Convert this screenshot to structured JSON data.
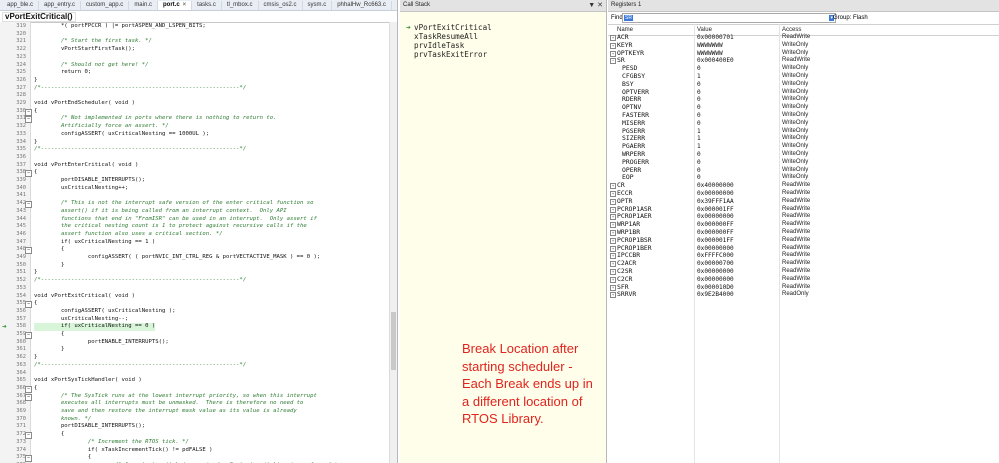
{
  "editor": {
    "tabs": [
      "app_ble.c",
      "app_entry.c",
      "custom_app.c",
      "main.c",
      "port.c",
      "tasks.c",
      "tl_mbox.c",
      "cmsis_os2.c",
      "sysm.c",
      "phhalHw_Rc663.c"
    ],
    "active_tab": "port.c",
    "function_selector": "vPortExitCritical()",
    "lines": [
      {
        "n": "319",
        "t": "        *( portFPCCR ) |= portASPEN_AND_LSPEN_BITS;",
        "c": "code"
      },
      {
        "n": "320",
        "t": "",
        "c": "code"
      },
      {
        "n": "321",
        "t": "        /* Start the first task. */",
        "c": "cm"
      },
      {
        "n": "322",
        "t": "        vPortStartFirstTask();",
        "c": "code"
      },
      {
        "n": "323",
        "t": "",
        "c": "code"
      },
      {
        "n": "324",
        "t": "        /* Should not get here! */",
        "c": "cm"
      },
      {
        "n": "325",
        "t": "        return 0;",
        "c": "code"
      },
      {
        "n": "326",
        "t": "}",
        "c": "code"
      },
      {
        "n": "327",
        "t": "/*-----------------------------------------------------------*/",
        "c": "sep"
      },
      {
        "n": "328",
        "t": "",
        "c": "code"
      },
      {
        "n": "329",
        "t": "void vPortEndScheduler( void )",
        "c": "code"
      },
      {
        "n": "330",
        "t": "{",
        "c": "code",
        "fold": true
      },
      {
        "n": "331",
        "t": "        /* Not implemented in ports where there is nothing to return to.",
        "c": "cm",
        "fold": true
      },
      {
        "n": "332",
        "t": "        Artificially force an assert. */",
        "c": "cm"
      },
      {
        "n": "333",
        "t": "        configASSERT( uxCriticalNesting == 1000UL );",
        "c": "code"
      },
      {
        "n": "334",
        "t": "}",
        "c": "code"
      },
      {
        "n": "335",
        "t": "/*-----------------------------------------------------------*/",
        "c": "sep"
      },
      {
        "n": "336",
        "t": "",
        "c": "code"
      },
      {
        "n": "337",
        "t": "void vPortEnterCritical( void )",
        "c": "code"
      },
      {
        "n": "338",
        "t": "{",
        "c": "code",
        "fold": true
      },
      {
        "n": "339",
        "t": "        portDISABLE_INTERRUPTS();",
        "c": "code"
      },
      {
        "n": "340",
        "t": "        uxCriticalNesting++;",
        "c": "code"
      },
      {
        "n": "341",
        "t": "",
        "c": "code"
      },
      {
        "n": "342",
        "t": "        /* This is not the interrupt safe version of the enter critical function so",
        "c": "cm",
        "fold": true
      },
      {
        "n": "343",
        "t": "        assert() if it is being called from an interrupt context.  Only API",
        "c": "cm"
      },
      {
        "n": "344",
        "t": "        functions that end in \"FromISR\" can be used in an interrupt.  Only assert if",
        "c": "cm"
      },
      {
        "n": "345",
        "t": "        the critical nesting count is 1 to protect against recursive calls if the",
        "c": "cm"
      },
      {
        "n": "346",
        "t": "        assert function also uses a critical section. */",
        "c": "cm"
      },
      {
        "n": "347",
        "t": "        if( uxCriticalNesting == 1 )",
        "c": "code"
      },
      {
        "n": "348",
        "t": "        {",
        "c": "code",
        "fold": true
      },
      {
        "n": "349",
        "t": "                configASSERT( ( portNVIC_INT_CTRL_REG & portVECTACTIVE_MASK ) == 0 );",
        "c": "code"
      },
      {
        "n": "350",
        "t": "        }",
        "c": "code"
      },
      {
        "n": "351",
        "t": "}",
        "c": "code"
      },
      {
        "n": "352",
        "t": "/*-----------------------------------------------------------*/",
        "c": "sep"
      },
      {
        "n": "353",
        "t": "",
        "c": "code"
      },
      {
        "n": "354",
        "t": "void vPortExitCritical( void )",
        "c": "code"
      },
      {
        "n": "355",
        "t": "{",
        "c": "code",
        "fold": true
      },
      {
        "n": "356",
        "t": "        configASSERT( uxCriticalNesting );",
        "c": "code"
      },
      {
        "n": "357",
        "t": "        uxCriticalNesting--;",
        "c": "code"
      },
      {
        "n": "358",
        "t": "        if( uxCriticalNesting == 0 )",
        "c": "code",
        "cur": true
      },
      {
        "n": "359",
        "t": "        {",
        "c": "code",
        "fold": true
      },
      {
        "n": "360",
        "t": "                portENABLE_INTERRUPTS();",
        "c": "code"
      },
      {
        "n": "361",
        "t": "        }",
        "c": "code"
      },
      {
        "n": "362",
        "t": "}",
        "c": "code"
      },
      {
        "n": "363",
        "t": "/*-----------------------------------------------------------*/",
        "c": "sep"
      },
      {
        "n": "364",
        "t": "",
        "c": "code"
      },
      {
        "n": "365",
        "t": "void xPortSysTickHandler( void )",
        "c": "code"
      },
      {
        "n": "366",
        "t": "{",
        "c": "code",
        "fold": true
      },
      {
        "n": "367",
        "t": "        /* The SysTick runs at the lowest interrupt priority, so when this interrupt",
        "c": "cm",
        "fold": true
      },
      {
        "n": "368",
        "t": "        executes all interrupts must be unmasked.  There is therefore no need to",
        "c": "cm"
      },
      {
        "n": "369",
        "t": "        save and then restore the interrupt mask value as its value is already",
        "c": "cm"
      },
      {
        "n": "370",
        "t": "        known. */",
        "c": "cm"
      },
      {
        "n": "371",
        "t": "        portDISABLE_INTERRUPTS();",
        "c": "code"
      },
      {
        "n": "372",
        "t": "        {",
        "c": "code",
        "fold": true
      },
      {
        "n": "373",
        "t": "                /* Increment the RTOS tick. */",
        "c": "cm"
      },
      {
        "n": "374",
        "t": "                if( xTaskIncrementTick() != pdFALSE )",
        "c": "code"
      },
      {
        "n": "375",
        "t": "                {",
        "c": "code",
        "fold": true
      },
      {
        "n": "376",
        "t": "                        /* A context switch is required.  Context switching is performed in",
        "c": "cm"
      }
    ]
  },
  "callstack": {
    "title": "Call Stack",
    "controls": "▼ ✕",
    "frames": [
      "vPortExitCritical",
      "xTaskResumeAll",
      "prvIdleTask",
      "prvTaskExitError"
    ],
    "note": "Break Location after starting scheduler - Each Break ends up in a different location of RTOS Library."
  },
  "registers": {
    "title": "Registers 1",
    "find_label": "Find:",
    "find_value": "SR",
    "group_label": "Group:",
    "group_value": "Flash",
    "columns": {
      "name": "Name",
      "value": "Value",
      "access": "Access"
    },
    "rows": [
      {
        "name": "ACR",
        "value": "0x00000701",
        "access": "ReadWrite",
        "kind": "top",
        "exp": "+"
      },
      {
        "name": "KEYR",
        "value": "WWWWWWW",
        "access": "WriteOnly",
        "kind": "top",
        "exp": "+"
      },
      {
        "name": "OPTKEYR",
        "value": "WWWWWWW",
        "access": "WriteOnly",
        "kind": "top",
        "exp": "+"
      },
      {
        "name": "SR",
        "value": "0x000400E0",
        "access": "ReadWrite",
        "kind": "top",
        "exp": "−"
      },
      {
        "name": "PESD",
        "value": "0",
        "access": "WriteOnly",
        "kind": "child"
      },
      {
        "name": "CFGBSY",
        "value": "1",
        "access": "WriteOnly",
        "kind": "child"
      },
      {
        "name": "BSY",
        "value": "0",
        "access": "WriteOnly",
        "kind": "child"
      },
      {
        "name": "OPTVERR",
        "value": "0",
        "access": "WriteOnly",
        "kind": "child"
      },
      {
        "name": "RDERR",
        "value": "0",
        "access": "WriteOnly",
        "kind": "child"
      },
      {
        "name": "OPTNV",
        "value": "0",
        "access": "WriteOnly",
        "kind": "child"
      },
      {
        "name": "FASTERR",
        "value": "0",
        "access": "WriteOnly",
        "kind": "child"
      },
      {
        "name": "MISERR",
        "value": "0",
        "access": "WriteOnly",
        "kind": "child"
      },
      {
        "name": "PGSERR",
        "value": "1",
        "access": "WriteOnly",
        "kind": "child"
      },
      {
        "name": "SIZERR",
        "value": "1",
        "access": "WriteOnly",
        "kind": "child"
      },
      {
        "name": "PGAERR",
        "value": "1",
        "access": "WriteOnly",
        "kind": "child"
      },
      {
        "name": "WRPERR",
        "value": "0",
        "access": "WriteOnly",
        "kind": "child"
      },
      {
        "name": "PROGERR",
        "value": "0",
        "access": "WriteOnly",
        "kind": "child"
      },
      {
        "name": "OPERR",
        "value": "0",
        "access": "WriteOnly",
        "kind": "child"
      },
      {
        "name": "EOP",
        "value": "0",
        "access": "WriteOnly",
        "kind": "child"
      },
      {
        "name": "CR",
        "value": "0x40000000",
        "access": "ReadWrite",
        "kind": "top",
        "exp": "+"
      },
      {
        "name": "ECCR",
        "value": "0x00000000",
        "access": "ReadWrite",
        "kind": "top",
        "exp": "+"
      },
      {
        "name": "OPTR",
        "value": "0x39FFF1AA",
        "access": "ReadWrite",
        "kind": "top",
        "exp": "+"
      },
      {
        "name": "PCROP1ASR",
        "value": "0x000001FF",
        "access": "ReadWrite",
        "kind": "top",
        "exp": "+"
      },
      {
        "name": "PCROP1AER",
        "value": "0x00000000",
        "access": "ReadWrite",
        "kind": "top",
        "exp": "+"
      },
      {
        "name": "WRP1AR",
        "value": "0x000000FF",
        "access": "ReadWrite",
        "kind": "top",
        "exp": "+"
      },
      {
        "name": "WRP1BR",
        "value": "0x000000FF",
        "access": "ReadWrite",
        "kind": "top",
        "exp": "+"
      },
      {
        "name": "PCROP1BSR",
        "value": "0x000001FF",
        "access": "ReadWrite",
        "kind": "top",
        "exp": "+"
      },
      {
        "name": "PCROP1BER",
        "value": "0x00000000",
        "access": "ReadWrite",
        "kind": "top",
        "exp": "+"
      },
      {
        "name": "IPCCBR",
        "value": "0xFFFFC000",
        "access": "ReadWrite",
        "kind": "top",
        "exp": "+"
      },
      {
        "name": "C2ACR",
        "value": "0x00000700",
        "access": "ReadWrite",
        "kind": "top",
        "exp": "+"
      },
      {
        "name": "C2SR",
        "value": "0x00000000",
        "access": "ReadWrite",
        "kind": "top",
        "exp": "+"
      },
      {
        "name": "C2CR",
        "value": "0x00000000",
        "access": "ReadWrite",
        "kind": "top",
        "exp": "+"
      },
      {
        "name": "SFR",
        "value": "0x000010D0",
        "access": "ReadWrite",
        "kind": "top",
        "exp": "+"
      },
      {
        "name": "SRRVR",
        "value": "0x9E2B4000",
        "access": "ReadOnly",
        "kind": "top",
        "exp": "+"
      }
    ]
  }
}
